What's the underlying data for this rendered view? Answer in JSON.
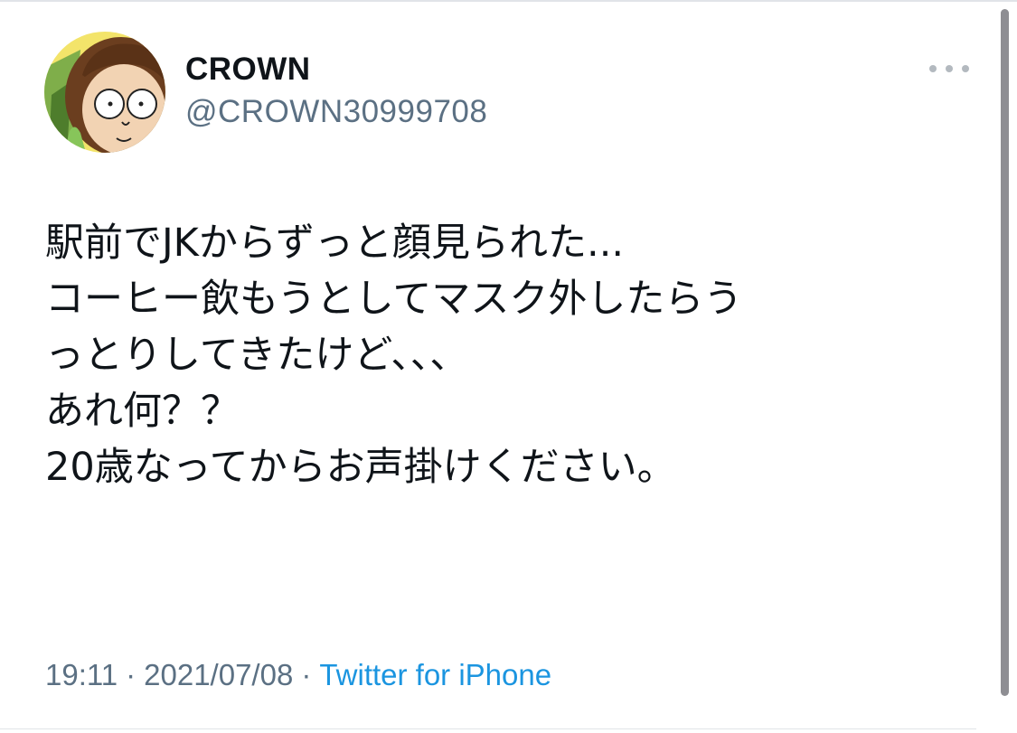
{
  "tweet": {
    "display_name": "CROWN",
    "handle": "@CROWN30999708",
    "text_lines": [
      "駅前でJKからずっと顔見られた...",
      "コーヒー飲もうとしてマスク外したらう",
      "っとりしてきたけど、、、",
      "あれ何？？",
      "20歳なってからお声掛けください。"
    ],
    "time": "19:11",
    "separator": "·",
    "date": "2021/07/08",
    "source": "Twitter for iPhone"
  },
  "icons": {
    "more": "more-horizontal-icon",
    "avatar": "cartoon-character-avatar"
  },
  "colors": {
    "text": "#0f1419",
    "secondary": "#5b7083",
    "link": "#1b95e0",
    "avatar_bg": "#f3e46a"
  }
}
